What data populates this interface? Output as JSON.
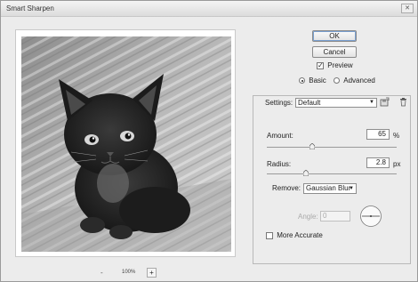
{
  "window": {
    "title": "Smart Sharpen",
    "close": "✕"
  },
  "preview": {
    "zoom_level": "100%",
    "zoom_out": "-",
    "zoom_in": "+"
  },
  "buttons": {
    "ok": "OK",
    "cancel": "Cancel"
  },
  "preview_checkbox": {
    "label": "Preview",
    "checked": true
  },
  "mode": {
    "basic": "Basic",
    "advanced": "Advanced",
    "selected": "Basic"
  },
  "settings": {
    "label": "Settings:",
    "value": "Default"
  },
  "amount": {
    "label": "Amount:",
    "value": "65",
    "unit": "%"
  },
  "radius": {
    "label": "Radius:",
    "value": "2.8",
    "unit": "px"
  },
  "remove": {
    "label": "Remove:",
    "value": "Gaussian Blur"
  },
  "angle": {
    "label": "Angle:",
    "value": "0"
  },
  "more_accurate": {
    "label": "More Accurate",
    "checked": false
  },
  "icons": {
    "save": "save-settings-icon",
    "delete": "trash-icon",
    "dial": "angle-dial-icon"
  }
}
